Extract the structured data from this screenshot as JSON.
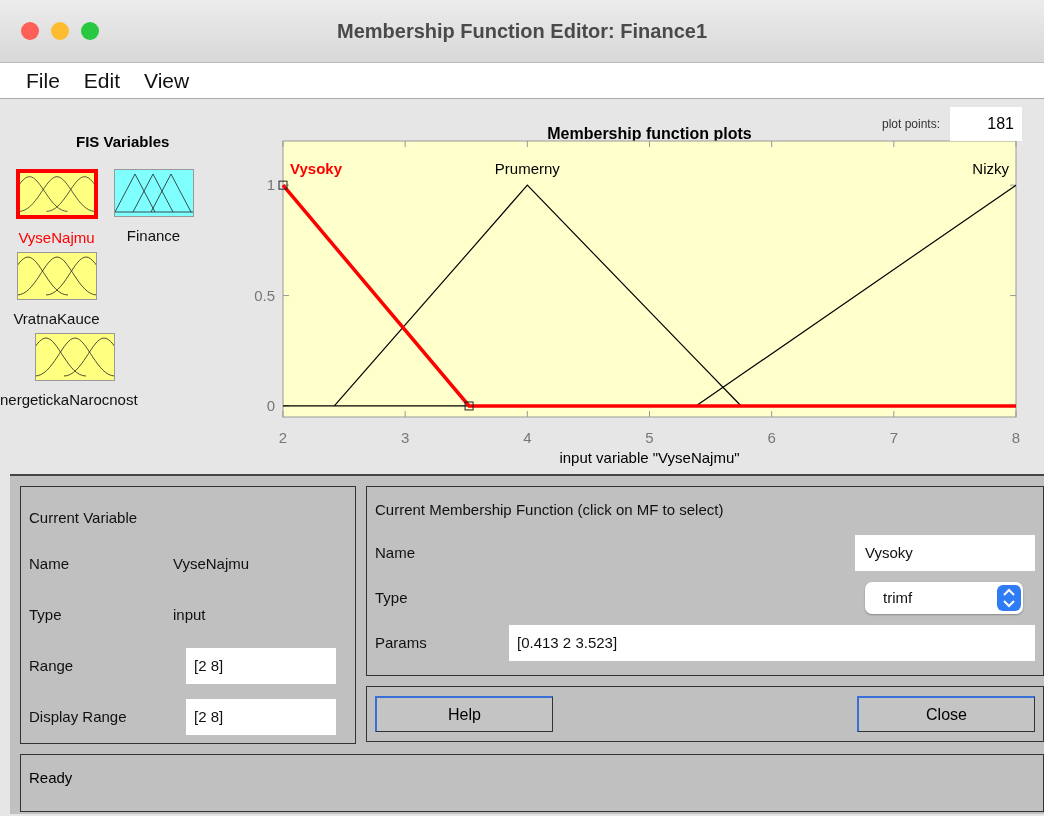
{
  "window": {
    "title": "Membership Function Editor: Finance1"
  },
  "menu": [
    "File",
    "Edit",
    "View"
  ],
  "fis_variables": {
    "title": "FIS Variables",
    "items": [
      {
        "name": "VyseNajmu",
        "kind": "input",
        "selected": true
      },
      {
        "name": "Finance",
        "kind": "output",
        "selected": false
      },
      {
        "name": "VratnaKauce",
        "kind": "input",
        "selected": false
      },
      {
        "name": "nergetickaNarocnost",
        "kind": "input",
        "selected": false
      }
    ]
  },
  "plot": {
    "plot_points_label": "plot points:",
    "plot_points": "181",
    "chart_data": {
      "type": "line",
      "title": "Membership function plots",
      "xlabel": "input variable \"VyseNajmu\"",
      "x": [
        2,
        2.42,
        3.523,
        4,
        5.38,
        5.75,
        8
      ],
      "xlim": [
        2,
        8
      ],
      "ylim": [
        -0.05,
        1.2
      ],
      "xticks": [
        2,
        3,
        4,
        5,
        6,
        7,
        8
      ],
      "yticks": [
        0,
        0.5,
        1
      ],
      "series": [
        {
          "name": "Vysoky",
          "color": "#ff0000",
          "values": [
            1,
            0.724,
            0,
            0,
            0,
            0,
            0
          ]
        },
        {
          "name": "Prumerny",
          "color": "#000000",
          "values": [
            null,
            0,
            0.698,
            1,
            0.211,
            0,
            null
          ]
        },
        {
          "name": "Nizky",
          "color": "#000000",
          "values": [
            null,
            null,
            null,
            null,
            0,
            0.141,
            1
          ]
        }
      ]
    },
    "mf_states": [
      {
        "selected": true
      },
      {
        "selected": false
      },
      {
        "selected": false
      }
    ]
  },
  "current_variable": {
    "title": "Current Variable",
    "fields": [
      {
        "label": "Name",
        "value": "VyseNajmu",
        "kind": "text"
      },
      {
        "label": "Type",
        "value": "input",
        "kind": "text"
      },
      {
        "label": "Range",
        "value": "[2 8]",
        "kind": "field"
      },
      {
        "label": "Display Range",
        "value": "[2 8]",
        "kind": "field"
      }
    ]
  },
  "current_mf": {
    "title": "Current Membership Function (click on MF to select)",
    "fields": [
      {
        "label": "Name",
        "value": "Vysoky",
        "kind": "field"
      },
      {
        "label": "Type",
        "value": "trimf",
        "kind": "select"
      },
      {
        "label": "Params",
        "value": "[0.413 2 3.523]",
        "kind": "wide"
      }
    ]
  },
  "buttons": [
    "Help",
    "Close"
  ],
  "status": "Ready"
}
